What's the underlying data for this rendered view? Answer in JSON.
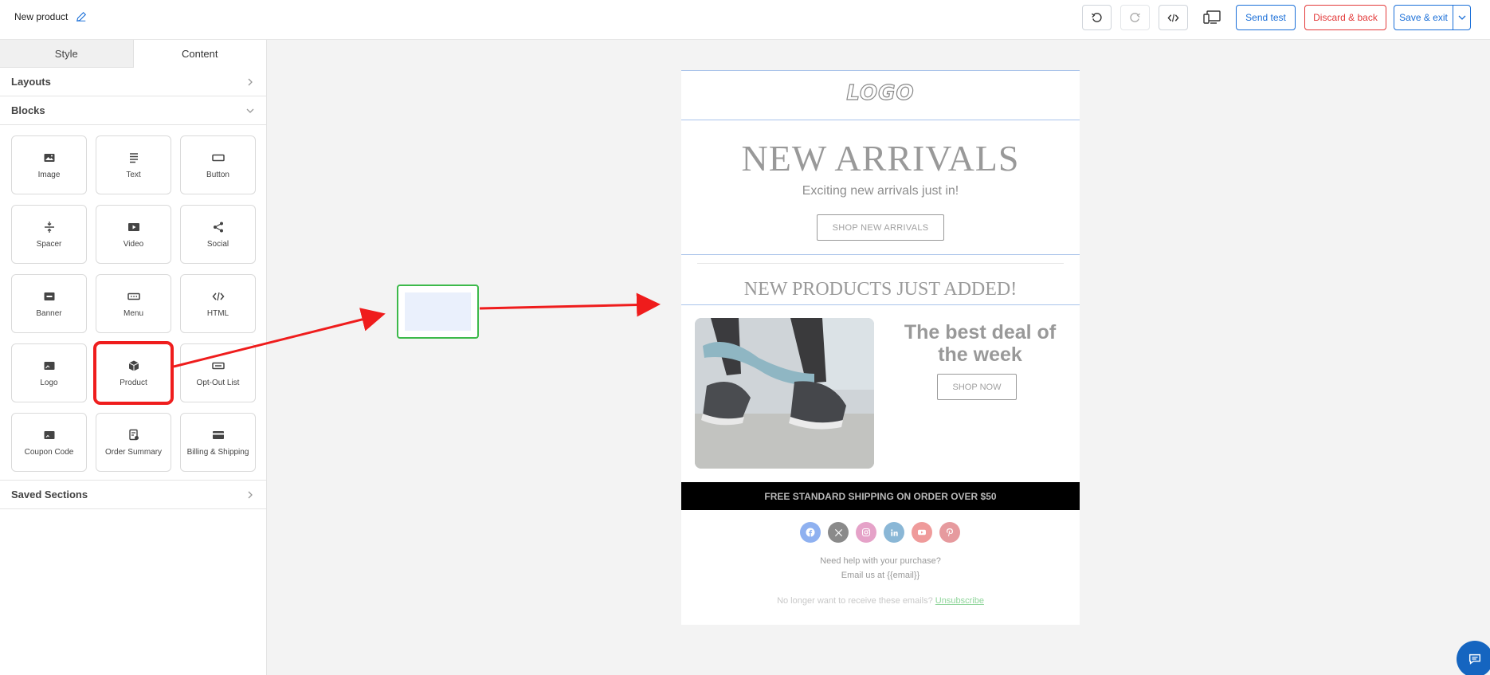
{
  "header": {
    "title": "New product",
    "send_test": "Send test",
    "discard_back": "Discard & back",
    "save_exit": "Save & exit"
  },
  "sidebar": {
    "tabs": [
      {
        "label": "Style"
      },
      {
        "label": "Content"
      }
    ],
    "layouts_label": "Layouts",
    "blocks_label": "Blocks",
    "saved_label": "Saved Sections",
    "blocks": [
      {
        "label": "Image",
        "icon": "image-icon"
      },
      {
        "label": "Text",
        "icon": "text-icon"
      },
      {
        "label": "Button",
        "icon": "button-icon"
      },
      {
        "label": "Spacer",
        "icon": "spacer-icon"
      },
      {
        "label": "Video",
        "icon": "video-icon"
      },
      {
        "label": "Social",
        "icon": "share-icon"
      },
      {
        "label": "Banner",
        "icon": "banner-icon"
      },
      {
        "label": "Menu",
        "icon": "menu-icon"
      },
      {
        "label": "HTML",
        "icon": "code-icon"
      },
      {
        "label": "Logo",
        "icon": "logo-icon"
      },
      {
        "label": "Product",
        "icon": "box-icon"
      },
      {
        "label": "Opt-Out List",
        "icon": "list-icon"
      },
      {
        "label": "Coupon Code",
        "icon": "coupon-icon"
      },
      {
        "label": "Order Summary",
        "icon": "order-icon"
      },
      {
        "label": "Billing & Shipping",
        "icon": "card-icon"
      }
    ]
  },
  "email": {
    "logo": "LOGO",
    "hero_title": "NEW ARRIVALS",
    "hero_subtitle": "Exciting new arrivals just in!",
    "hero_button": "SHOP NEW ARRIVALS",
    "products_heading": "NEW PRODUCTS JUST ADDED!",
    "deal_title": "The best deal of the week",
    "deal_button": "SHOP NOW",
    "shipping_bar": "FREE STANDARD SHIPPING ON ORDER OVER $50",
    "help_line1": "Need help with your purchase?",
    "help_line2": "Email us at {{email}}",
    "unsub_text": "No longer want to receive these emails?",
    "unsub_link": "Unsubscribe"
  },
  "colors": {
    "accent": "#1a6fd8",
    "danger": "#e33a3a",
    "highlight": "#ef1c1c",
    "drop_zone": "#3cb94a"
  }
}
